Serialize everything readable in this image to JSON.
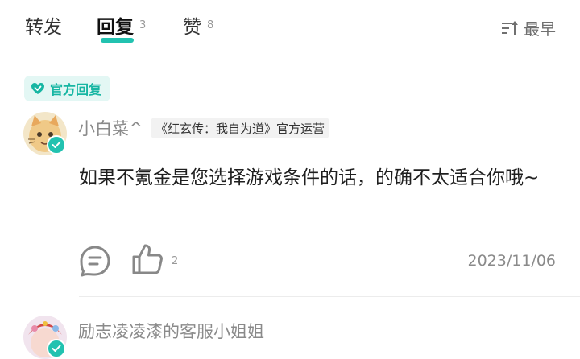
{
  "tabs": [
    {
      "label": "转发",
      "count": ""
    },
    {
      "label": "回复",
      "count": "3"
    },
    {
      "label": "赞",
      "count": "8"
    }
  ],
  "sort": {
    "label": "最早"
  },
  "official_badge": {
    "label": "官方回复"
  },
  "comments": [
    {
      "username": "小白菜^",
      "tag": "《红玄传：我自为道》官方运营",
      "text": "如果不氪金是您选择游戏条件的话，的确不太适合你哦~",
      "likes": "2",
      "date": "2023/11/06"
    },
    {
      "username": "励志凌凌漆的客服小姐姐"
    }
  ],
  "colors": {
    "accent": "#22c2b0",
    "badge_bg": "#e3f7f4",
    "muted": "#8a8a8a"
  },
  "icons": [
    "sort-icon",
    "heart-icon",
    "verified-icon",
    "reply-icon",
    "thumb-up-icon"
  ]
}
